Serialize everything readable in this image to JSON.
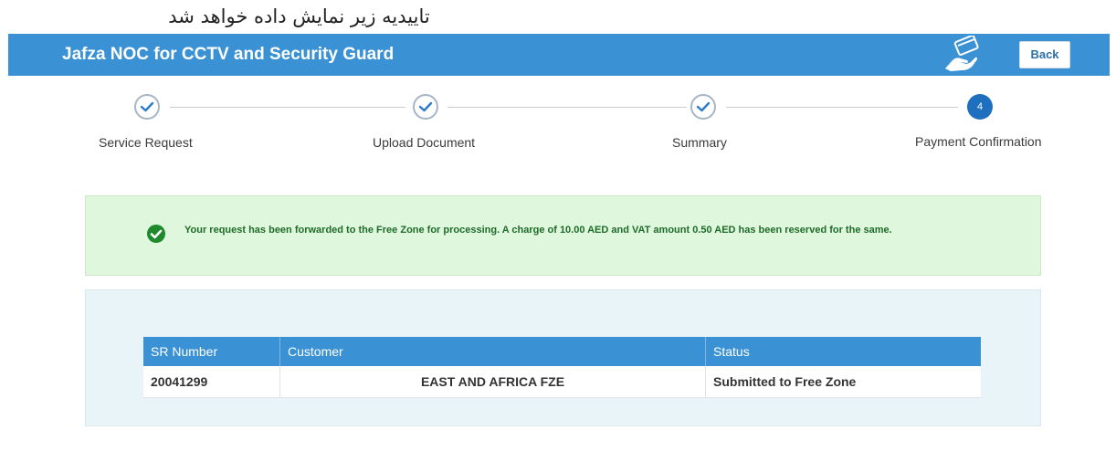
{
  "annotation": {
    "text": "تاییدیه زیر نمایش داده خواهد شد"
  },
  "header": {
    "title": "Jafza NOC for CCTV and Security Guard",
    "back_label": "Back",
    "icon": "card-payment-icon"
  },
  "stepper": {
    "steps": [
      {
        "label": "Service Request",
        "status": "done"
      },
      {
        "label": "Upload Document",
        "status": "done"
      },
      {
        "label": "Summary",
        "status": "done"
      },
      {
        "label": "Payment Confirmation",
        "status": "active",
        "number": "4"
      }
    ]
  },
  "alert": {
    "icon": "check-circle-icon",
    "message": "Your request has been forwarded to the Free Zone for processing. A charge of 10.00 AED and VAT amount 0.50 AED has been reserved for the same."
  },
  "table": {
    "columns": [
      "SR Number",
      "Customer",
      "Status"
    ],
    "rows": [
      {
        "sr_number": "20041299",
        "customer": "EAST AND AFRICA FZE",
        "status": "Submitted to Free Zone"
      }
    ]
  },
  "colors": {
    "header": "#3a91d3",
    "active_step": "#1f6fbf",
    "alert_bg": "#dff7dc",
    "alert_text": "#1f6b2a",
    "panel_bg": "#e9f4f8"
  }
}
